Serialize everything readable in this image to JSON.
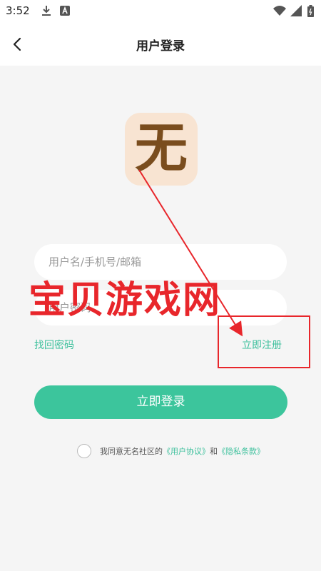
{
  "status_bar": {
    "time": "3:52"
  },
  "header": {
    "title": "用户登录"
  },
  "logo": {
    "char": "无"
  },
  "form": {
    "username_placeholder": "用户名/手机号/邮箱",
    "password_placeholder": "用户密码",
    "forgot_password": "找回密码",
    "register": "立即注册",
    "login_button": "立即登录"
  },
  "agreement": {
    "prefix": "我同意无名社区的",
    "user_agreement": "《用户协议》",
    "and": "和",
    "privacy_policy": "《隐私条款》"
  },
  "watermark": {
    "text": "宝贝游戏网"
  },
  "colors": {
    "accent": "#3cc59c",
    "annotation_red": "#e8262b"
  }
}
